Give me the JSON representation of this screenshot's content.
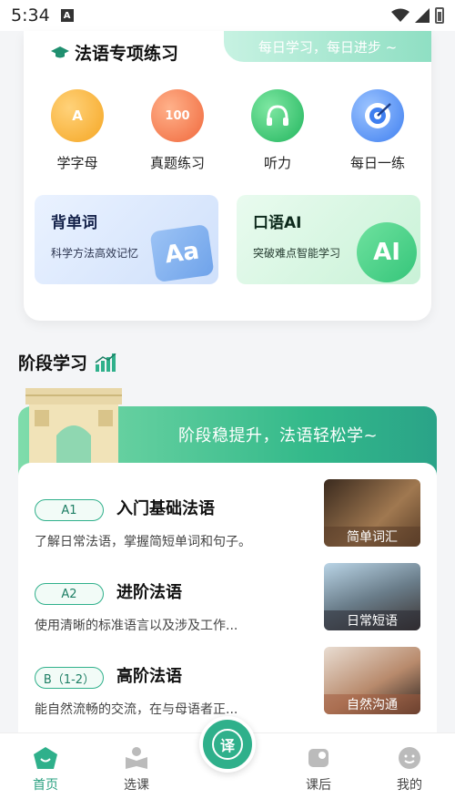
{
  "status_bar": {
    "time": "5:34",
    "a_icon": "A"
  },
  "practice": {
    "title": "法语专项练习",
    "slogan": "每日学习，每日进步 ~",
    "features": [
      {
        "label": "学字母",
        "icon": "alphabet-book-icon",
        "glyph": "A"
      },
      {
        "label": "真题练习",
        "icon": "exam-score-icon",
        "glyph": "100"
      },
      {
        "label": "听力",
        "icon": "listening-icon",
        "glyph": ""
      },
      {
        "label": "每日一练",
        "icon": "target-icon",
        "glyph": ""
      }
    ],
    "promos": [
      {
        "title": "背单词",
        "subtitle": "科学方法高效记忆",
        "deco": "Aa"
      },
      {
        "title": "口语AI",
        "subtitle": "突破难点智能学习",
        "deco": "AI"
      }
    ]
  },
  "stage": {
    "title": "阶段学习",
    "slogan": "阶段稳提升，法语轻松学~",
    "courses": [
      {
        "level": "A1",
        "title": "入门基础法语",
        "desc": "了解日常法语，掌握简短单词和句子。",
        "thumb_label": "简单词汇"
      },
      {
        "level": "A2",
        "title": "进阶法语",
        "desc": "使用清晰的标准语言以及涉及工作...",
        "thumb_label": "日常短语"
      },
      {
        "level": "B（1-2）",
        "title": "高阶法语",
        "desc": "能自然流畅的交流，在与母语者正...",
        "thumb_label": "自然沟通"
      }
    ]
  },
  "nav": {
    "items": [
      {
        "label": "首页",
        "icon": "home-icon"
      },
      {
        "label": "选课",
        "icon": "course-select-icon"
      },
      {
        "label": "课后",
        "icon": "after-class-icon"
      },
      {
        "label": "我的",
        "icon": "profile-icon"
      }
    ],
    "center_glyph": "译"
  },
  "colors": {
    "accent": "#2fb08b",
    "accent_dark": "#1d7e64"
  }
}
